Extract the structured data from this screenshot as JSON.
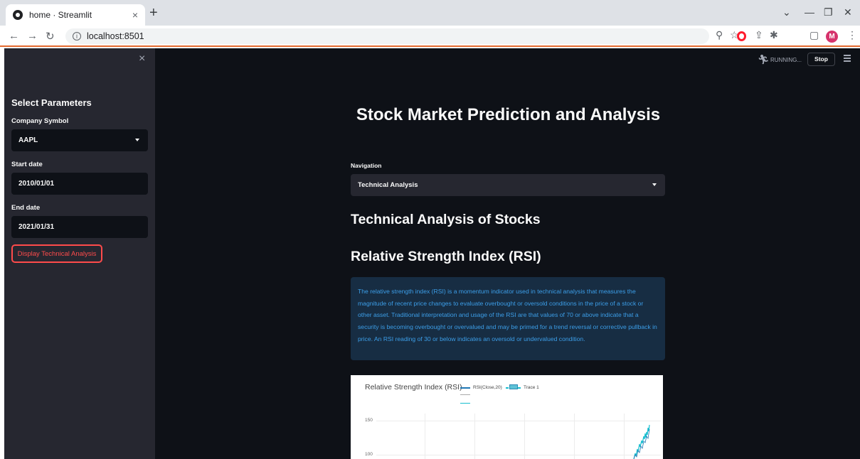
{
  "browser": {
    "tab_title": "home · Streamlit",
    "tab_close": "×",
    "new_tab": "+",
    "url": "localhost:8501",
    "profile_initial": "M"
  },
  "sidebar": {
    "close": "×",
    "title": "Select Parameters",
    "company_label": "Company Symbol",
    "company_value": "AAPL",
    "start_label": "Start date",
    "start_value": "2010/01/01",
    "end_label": "End date",
    "end_value": "2021/01/31",
    "button_label": "Display Technical Analysis"
  },
  "status": {
    "running": "RUNNING...",
    "stop": "Stop"
  },
  "main": {
    "title": "Stock Market Prediction and Analysis",
    "nav_label": "Navigation",
    "nav_value": "Technical Analysis",
    "section_title": "Technical Analysis of Stocks",
    "rsi_title": "Relative Strength Index (RSI)",
    "rsi_info": "The relative strength index (RSI) is a momentum indicator used in technical analysis that measures the magnitude of recent price changes to evaluate overbought or oversold conditions in the price of a stock or other asset. Traditional interpretation and usage of the RSI are that values of 70 or above indicate that a security is becoming overbought or overvalued and may be primed for a trend reversal or corrective pullback in price. An RSI reading of 30 or below indicates an oversold or undervalued condition."
  },
  "chart_data": {
    "type": "line",
    "title": "Relative Strength Index (RSI)",
    "legend": [
      "RSI(Close,20)",
      "Trace 1"
    ],
    "y_ticks": [
      150,
      100
    ],
    "colors": {
      "rsi": "#1f77b4",
      "trace": "#17becf"
    }
  }
}
